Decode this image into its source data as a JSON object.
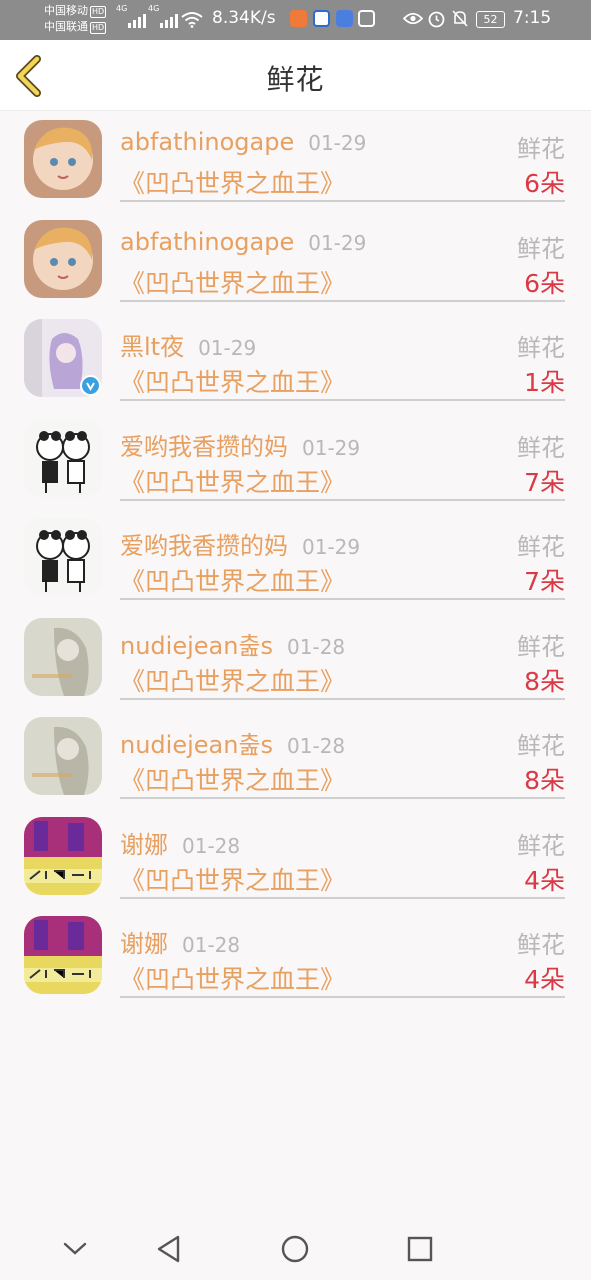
{
  "status_bar": {
    "carrier1": "中国移动",
    "carrier2": "中国联通",
    "hd1": "HD",
    "hd2": "HD",
    "net1": "4G",
    "net2": "4G",
    "speed": "8.34K/s",
    "battery": "52",
    "time": "7:15"
  },
  "header": {
    "title": "鲜花"
  },
  "list": {
    "items": [
      {
        "name": "abfathinogape",
        "date": "01-29",
        "type": "鲜花",
        "book": "《凹凸世界之血王》",
        "count": "6朵",
        "avatar": "anime-girl-avatar"
      },
      {
        "name": "abfathinogape",
        "date": "01-29",
        "type": "鲜花",
        "book": "《凹凸世界之血王》",
        "count": "6朵",
        "avatar": "anime-girl-avatar"
      },
      {
        "name": "黑lt夜",
        "date": "01-29",
        "type": "鲜花",
        "book": "《凹凸世界之血王》",
        "count": "1朵",
        "avatar": "purple-hair-avatar"
      },
      {
        "name": "爱哟我香攒的妈",
        "date": "01-29",
        "type": "鲜花",
        "book": "《凹凸世界之血王》",
        "count": "7朵",
        "avatar": "cartoon-couple-avatar"
      },
      {
        "name": "爱哟我香攒的妈",
        "date": "01-29",
        "type": "鲜花",
        "book": "《凹凸世界之血王》",
        "count": "7朵",
        "avatar": "cartoon-couple-avatar"
      },
      {
        "name": "nudiejean춢s",
        "date": "01-28",
        "type": "鲜花",
        "book": "《凹凸世界之血王》",
        "count": "8朵",
        "avatar": "faded-girl-avatar"
      },
      {
        "name": "nudiejean춢s",
        "date": "01-28",
        "type": "鲜花",
        "book": "《凹凸世界之血王》",
        "count": "8朵",
        "avatar": "faded-girl-avatar"
      },
      {
        "name": "谢娜",
        "date": "01-28",
        "type": "鲜花",
        "book": "《凹凸世界之血王》",
        "count": "4朵",
        "avatar": "colorful-text-avatar"
      },
      {
        "name": "谢娜",
        "date": "01-28",
        "type": "鲜花",
        "book": "《凹凸世界之血王》",
        "count": "4朵",
        "avatar": "colorful-text-avatar"
      }
    ]
  },
  "colors": {
    "name": "#e8a060",
    "count": "#d93a45",
    "muted": "#b8b8b8",
    "back_arrow": "#e8c84a"
  }
}
